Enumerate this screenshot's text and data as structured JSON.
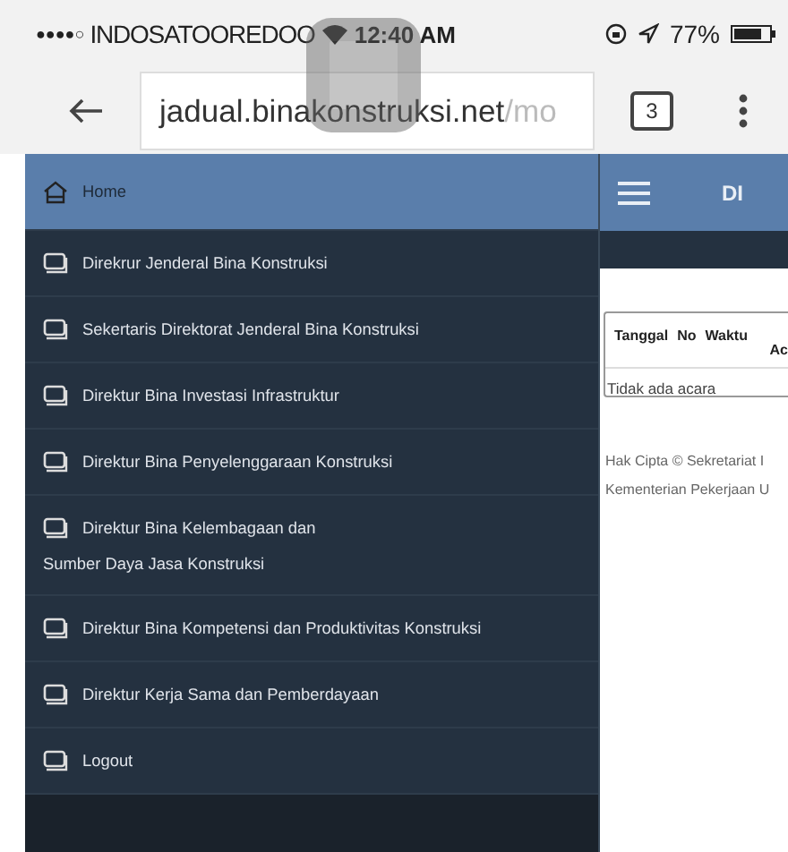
{
  "status_bar": {
    "signal": "●●●●○",
    "carrier": "INDOSATOOREDOO",
    "time": "12:40 AM",
    "battery": "77%"
  },
  "browser": {
    "url_host": "jadual.binakonstruksi.net",
    "url_path": "/mo",
    "tab_count": "3"
  },
  "sidebar": {
    "items": [
      {
        "label": "Home",
        "kind": "home",
        "selected": true
      },
      {
        "label": "Direkrur Jenderal Bina Konstruksi",
        "kind": "page",
        "selected": false
      },
      {
        "label": "Sekertaris Direktorat Jenderal Bina Konstruksi",
        "kind": "page",
        "selected": false
      },
      {
        "label": "Direktur Bina Investasi Infrastruktur",
        "kind": "page",
        "selected": false
      },
      {
        "label": "Direktur Bina Penyelenggaraan Konstruksi",
        "kind": "page",
        "selected": false
      },
      {
        "label": "Direktur Bina Kelembagaan dan",
        "label_2": "Sumber Daya Jasa Konstruksi",
        "kind": "page",
        "selected": false
      },
      {
        "label": "Direktur Bina Kompetensi dan Produktivitas Konstruksi",
        "kind": "page",
        "selected": false
      },
      {
        "label": "Direktur Kerja Sama dan Pemberdayaan",
        "kind": "page",
        "selected": false
      },
      {
        "label": "Logout",
        "kind": "page",
        "selected": false
      }
    ]
  },
  "main": {
    "header_title": "DI",
    "table": {
      "columns": [
        "Tanggal",
        "No",
        "Waktu"
      ],
      "column_4": "Ac",
      "empty_text": "Tidak ada acara"
    },
    "footer": [
      "Hak Cipta © Sekretariat I",
      "Kementerian Pekerjaan U"
    ]
  }
}
